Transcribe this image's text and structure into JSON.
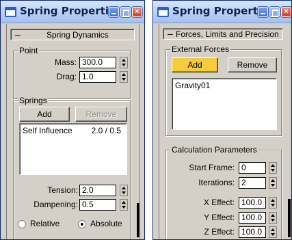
{
  "left_window": {
    "title": "Spring Properti...",
    "rollout": {
      "toggle": "–",
      "label": "Spring Dynamics"
    },
    "point_group": {
      "label": "Point",
      "mass_label": "Mass:",
      "mass_value": "300.0",
      "drag_label": "Drag:",
      "drag_value": "1.0"
    },
    "springs_group": {
      "label": "Springs",
      "add_label": "Add",
      "remove_label": "Remove",
      "list": [
        {
          "name": "Self Influence",
          "value": "2.0 / 0.5"
        }
      ],
      "tension_label": "Tension:",
      "tension_value": "2.0",
      "dampening_label": "Dampening:",
      "dampening_value": "0.5",
      "relative_label": "Relative",
      "absolute_label": "Absolute",
      "selected_mode": "Absolute"
    }
  },
  "right_window": {
    "title": "Spring Properti...",
    "rollout": {
      "toggle": "–",
      "label": "Forces, Limits and Precision"
    },
    "external_forces": {
      "label": "External Forces",
      "add_label": "Add",
      "remove_label": "Remove",
      "list": [
        "Gravity01"
      ]
    },
    "calculation": {
      "label": "Calculation Parameters",
      "start_frame_label": "Start Frame:",
      "start_frame_value": "0",
      "iterations_label": "Iterations:",
      "iterations_value": "2",
      "x_effect_label": "X Effect:",
      "x_effect_value": "100.0",
      "y_effect_label": "Y Effect:",
      "y_effect_value": "100.0",
      "z_effect_label": "Z Effect:",
      "z_effect_value": "100.0"
    }
  },
  "icons": {
    "window_icon": "app-window-icon",
    "minimize": "minimize-icon",
    "maximize": "maximize-icon",
    "close": "close-icon"
  },
  "colors": {
    "panel": "#d4d0c8",
    "titlebar": "#b8cff5",
    "active_button": "#f5cc3b",
    "close_button": "#c8402a"
  }
}
